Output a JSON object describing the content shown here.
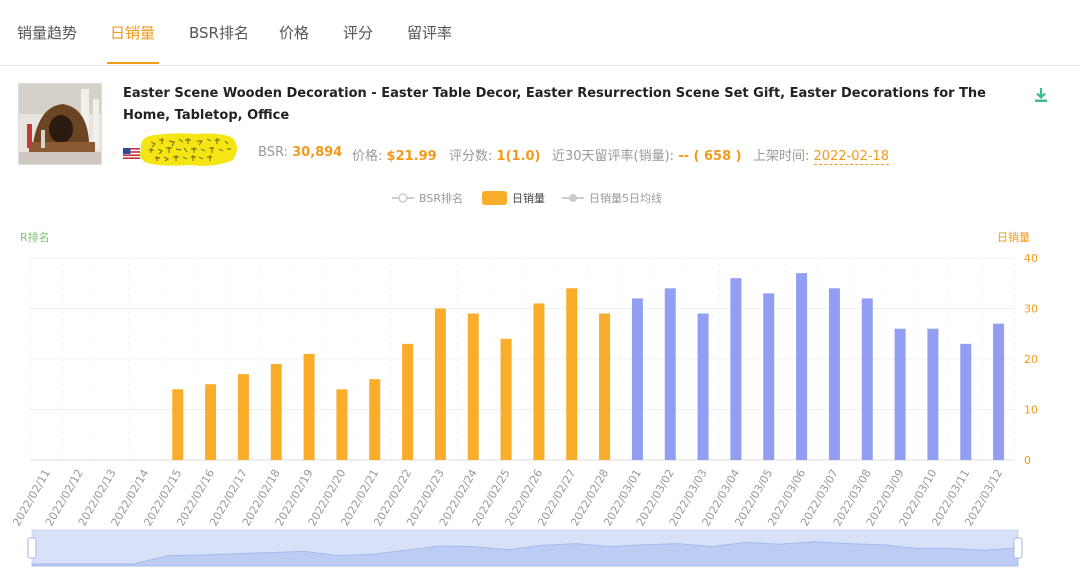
{
  "tabs": [
    {
      "label": "销量趋势",
      "active": false
    },
    {
      "label": "日销量",
      "active": true
    },
    {
      "label": "BSR排名",
      "active": false
    },
    {
      "label": "价格",
      "active": false
    },
    {
      "label": "评分",
      "active": false
    },
    {
      "label": "留评率",
      "active": false
    }
  ],
  "product": {
    "title": "Easter Scene Wooden Decoration - Easter Table Decor, Easter Resurrection Scene Set Gift, Easter Decorations for The Home, Tabletop, Office",
    "bsr_label": "BSR:",
    "bsr_value": "30,894",
    "price_label": "价格:",
    "price_value": "$21.99",
    "rating_label": "评分数:",
    "rating_value": "1(1.0)",
    "review_rate_label": "近30天留评率(销量):",
    "review_rate_value": "-- ( 658 )",
    "listed_label": "上架时间:",
    "listed_value": "2022-02-18",
    "marketplace_icon": "us-flag-icon",
    "stamp_text": "卖家精灵"
  },
  "legend": [
    {
      "label": "BSR排名",
      "active": false
    },
    {
      "label": "日销量",
      "active": true
    },
    {
      "label": "日销量5日均线",
      "active": false
    }
  ],
  "colors": {
    "accent": "#f29a1a",
    "bar_orange": "#f9ad2a",
    "bar_blue": "#929ef2",
    "green_axis": "#7cc46e",
    "download": "#3dbd8a"
  },
  "chart_data": {
    "type": "bar",
    "left_axis_name": "R排名",
    "right_axis_name": "日销量",
    "right_axis_ticks": [
      "0",
      "10",
      "20",
      "30",
      "40"
    ],
    "ylim": [
      0,
      40
    ],
    "categories": [
      "2022/02/11",
      "2022/02/12",
      "2022/02/13",
      "2022/02/14",
      "2022/02/15",
      "2022/02/16",
      "2022/02/17",
      "2022/02/18",
      "2022/02/19",
      "2022/02/20",
      "2022/02/21",
      "2022/02/22",
      "2022/02/23",
      "2022/02/24",
      "2022/02/25",
      "2022/02/26",
      "2022/02/27",
      "2022/02/28",
      "2022/03/01",
      "2022/03/02",
      "2022/03/03",
      "2022/03/04",
      "2022/03/05",
      "2022/03/06",
      "2022/03/07",
      "2022/03/08",
      "2022/03/09",
      "2022/03/10",
      "2022/03/11",
      "2022/03/12"
    ],
    "values": [
      0,
      0,
      0,
      0,
      14,
      15,
      17,
      19,
      21,
      14,
      16,
      23,
      30,
      29,
      24,
      31,
      34,
      29,
      32,
      34,
      29,
      36,
      33,
      37,
      34,
      32,
      26,
      26,
      23,
      27
    ],
    "orange_until_index": 17,
    "grid": true
  }
}
